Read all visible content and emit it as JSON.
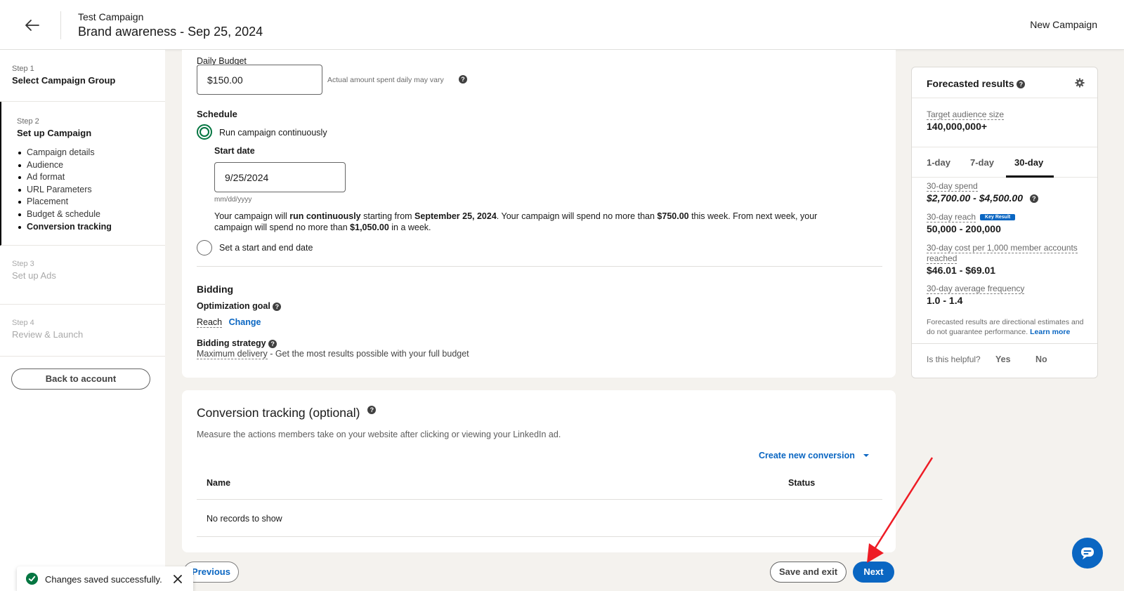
{
  "header": {
    "campaign_group": "Test Campaign",
    "title": "Brand awareness - Sep 25, 2024",
    "right_label": "New Campaign"
  },
  "sidebar": {
    "steps": [
      {
        "num": "Step 1",
        "name": "Select Campaign Group"
      },
      {
        "num": "Step 2",
        "name": "Set up Campaign"
      },
      {
        "num": "Step 3",
        "name": "Set up Ads"
      },
      {
        "num": "Step 4",
        "name": "Review & Launch"
      }
    ],
    "substeps": [
      "Campaign details",
      "Audience",
      "Ad format",
      "URL Parameters",
      "Placement",
      "Budget & schedule",
      "Conversion tracking"
    ],
    "back_label": "Back to account"
  },
  "budget": {
    "label": "Daily Budget",
    "value": "$150.00",
    "note": "Actual amount spent daily may vary"
  },
  "schedule": {
    "label": "Schedule",
    "option_continuous": "Run campaign continuously",
    "start_date_label": "Start date",
    "start_date_value": "9/25/2024",
    "date_format_hint": "mm/dd/yyyy",
    "summary_1": "Your campaign will ",
    "summary_2": "run continuously",
    "summary_3": " starting from ",
    "summary_4": "September 25, 2024",
    "summary_5": ". Your campaign will spend no more than ",
    "summary_6": "$750.00",
    "summary_7": " this week. From next week, your",
    "summary_8": "campaign will spend no more than ",
    "summary_9": "$1,050.00",
    "summary_10": " in a week.",
    "option_start_end": "Set a start and end date"
  },
  "bidding": {
    "label": "Bidding",
    "goal_label": "Optimization goal",
    "goal_value": "Reach",
    "change_link": "Change",
    "strategy_label": "Bidding strategy",
    "strategy_value": "Maximum delivery",
    "strategy_desc": " - Get the most results possible with your full budget"
  },
  "conversion": {
    "title": "Conversion tracking (optional)",
    "desc": "Measure the actions members take on your website after clicking or viewing your LinkedIn ad.",
    "create_link": "Create new conversion",
    "col_name": "Name",
    "col_status": "Status",
    "empty": "No records to show"
  },
  "forecast": {
    "title": "Forecasted results",
    "audience_label": "Target audience size",
    "audience_value": "140,000,000+",
    "tabs": [
      "1-day",
      "7-day",
      "30-day"
    ],
    "spend_label": "30-day spend",
    "spend_value": "$2,700.00 - $4,500.00",
    "reach_label": "30-day reach",
    "reach_badge": "Key Result",
    "reach_value": "50,000 - 200,000",
    "cpm_label_1": "30-day cost per 1,000 member accounts",
    "cpm_label_2": "reached",
    "cpm_value": "$46.01 - $69.01",
    "freq_label": "30-day average frequency",
    "freq_value": "1.0 - 1.4",
    "disclaimer_1": "Forecasted results are directional estimates and",
    "disclaimer_2": "do not guarantee performance. ",
    "learn_more": "Learn more",
    "helpful_q": "Is this helpful?",
    "yes": "Yes",
    "no": "No"
  },
  "footer": {
    "previous": "Previous",
    "save_exit": "Save and exit",
    "next": "Next"
  },
  "toast": {
    "message": "Changes saved successfully."
  },
  "colors": {
    "accent": "#0a66c2",
    "success": "#057642",
    "annotation_arrow": "#ee1c25"
  }
}
